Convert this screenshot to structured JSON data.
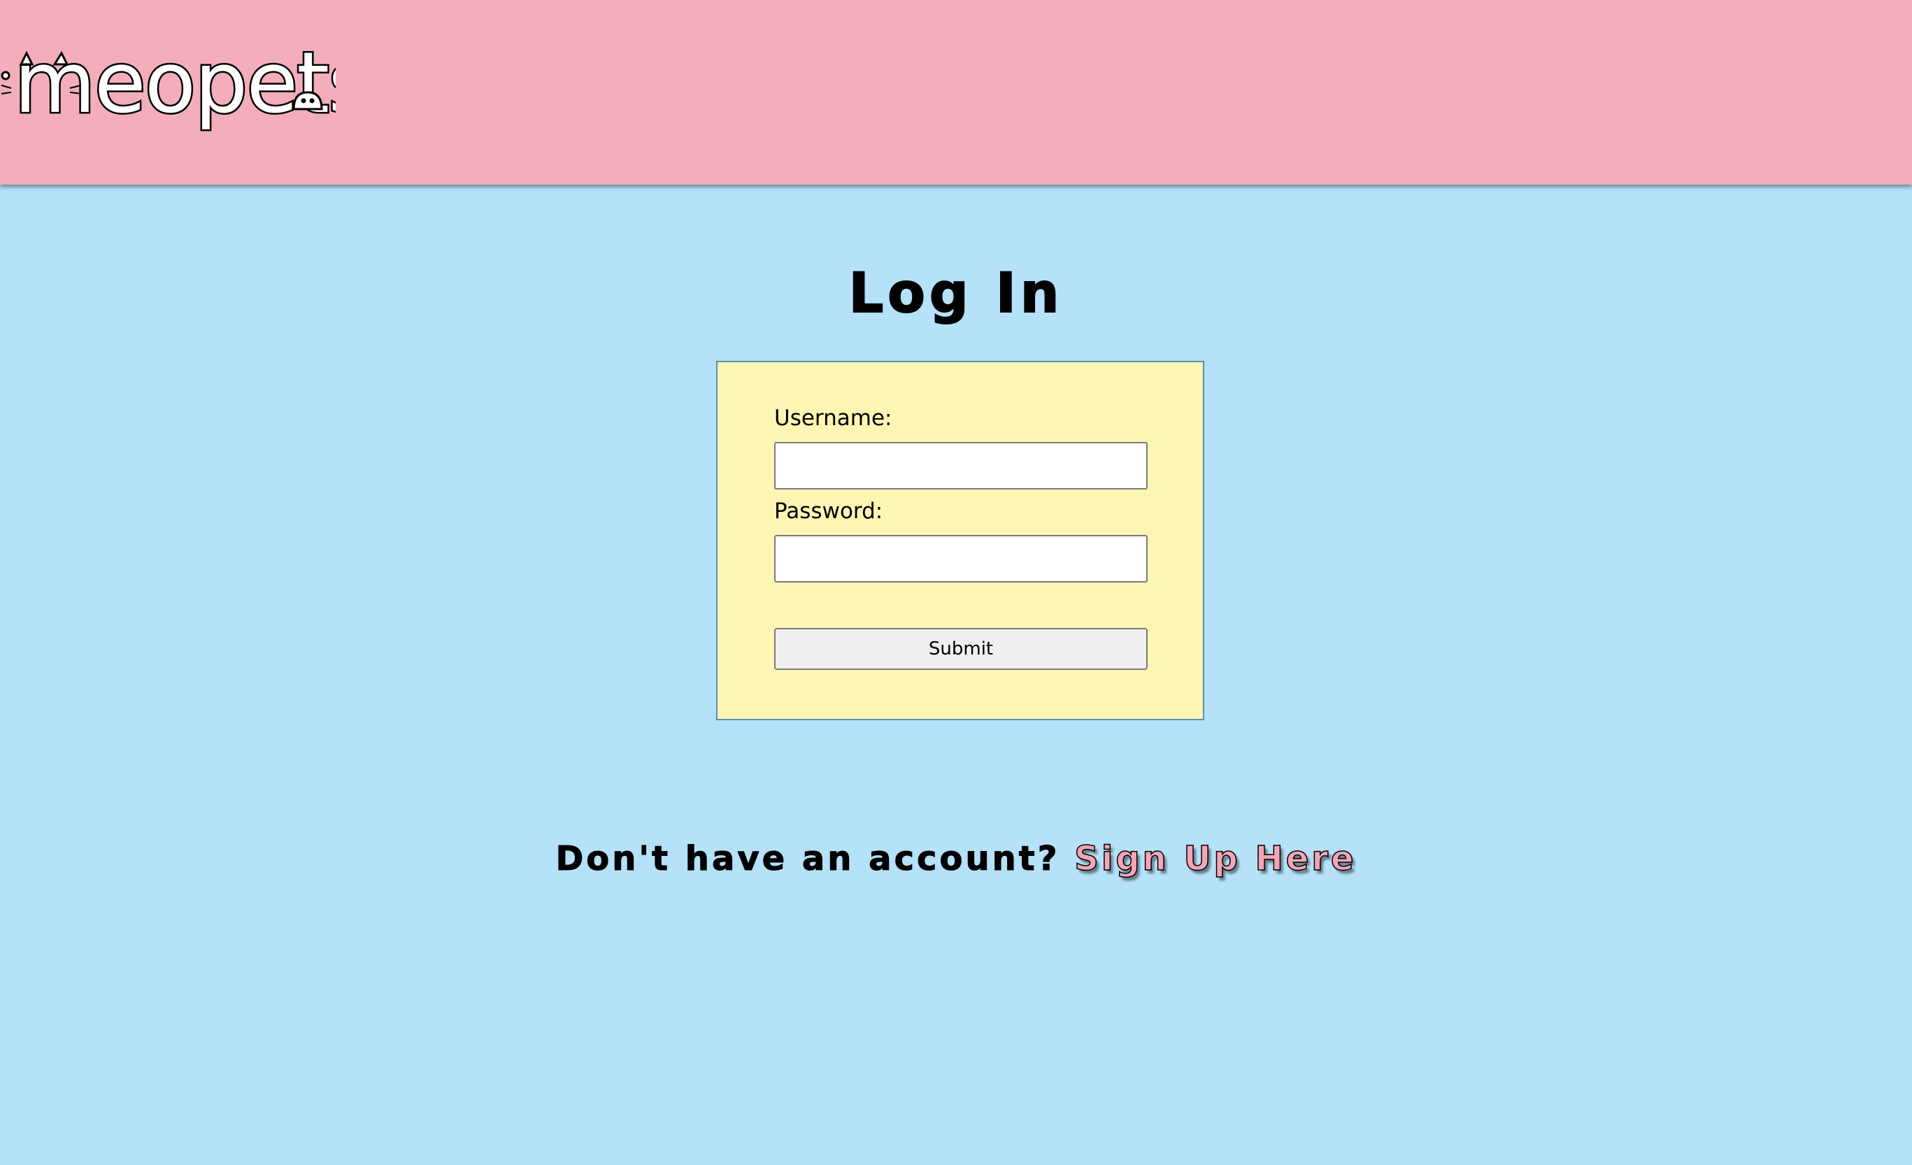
{
  "header": {
    "logo_text": "meopets"
  },
  "page": {
    "title": "Log In"
  },
  "login_form": {
    "username_label": "Username:",
    "username_value": "",
    "password_label": "Password:",
    "password_value": "",
    "submit_label": "Submit"
  },
  "signup": {
    "prompt": "Don't have an account?",
    "link_text": "Sign Up Here"
  },
  "colors": {
    "header_bg": "#f3adbb",
    "page_bg": "#b5e1f9",
    "form_bg": "#fdf5b4",
    "link_color": "#f3a5b6"
  }
}
